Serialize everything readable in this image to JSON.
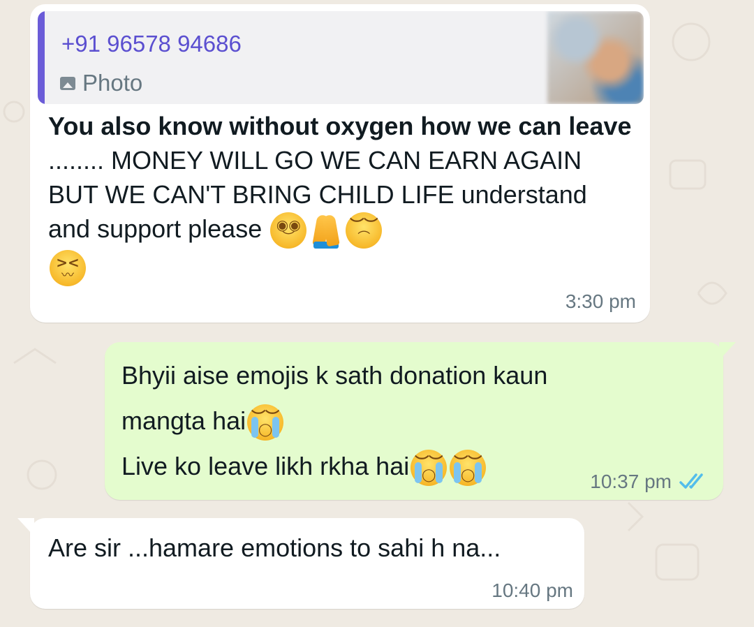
{
  "colors": {
    "background": "#efeae2",
    "incoming_bubble": "#ffffff",
    "outgoing_bubble": "#e4fcce",
    "quote_accent": "#6b5cd8",
    "quote_sender": "#5b4fd0",
    "timestamp": "#667781",
    "read_ticks": "#53bdeb"
  },
  "messages": [
    {
      "direction": "incoming",
      "quoted": {
        "sender": "+91 96578 94686",
        "type_icon": "photo-icon",
        "type_label": "Photo"
      },
      "text_bold": "You also know without oxygen how we can leave",
      "text_rest": " ........ MONEY WILL GO WE CAN EARN AGAIN  BUT WE CAN'T BRING CHILD LIFE understand and support please",
      "emojis": [
        "pleading-face",
        "folded-hands",
        "pensive-face",
        "confounded-face"
      ],
      "time": "3:30 pm"
    },
    {
      "direction": "outgoing",
      "line1": "Bhyii aise emojis k sath donation kaun",
      "line2": "mangta hai",
      "line3": "Live ko leave likh rkha hai",
      "emojis": [
        "loudly-crying-face",
        "loudly-crying-face",
        "loudly-crying-face"
      ],
      "time": "10:37 pm",
      "status_icon": "double-check-read-icon"
    },
    {
      "direction": "incoming",
      "text": "Are sir ...hamare emotions to sahi h na...",
      "time": "10:40 pm"
    }
  ]
}
